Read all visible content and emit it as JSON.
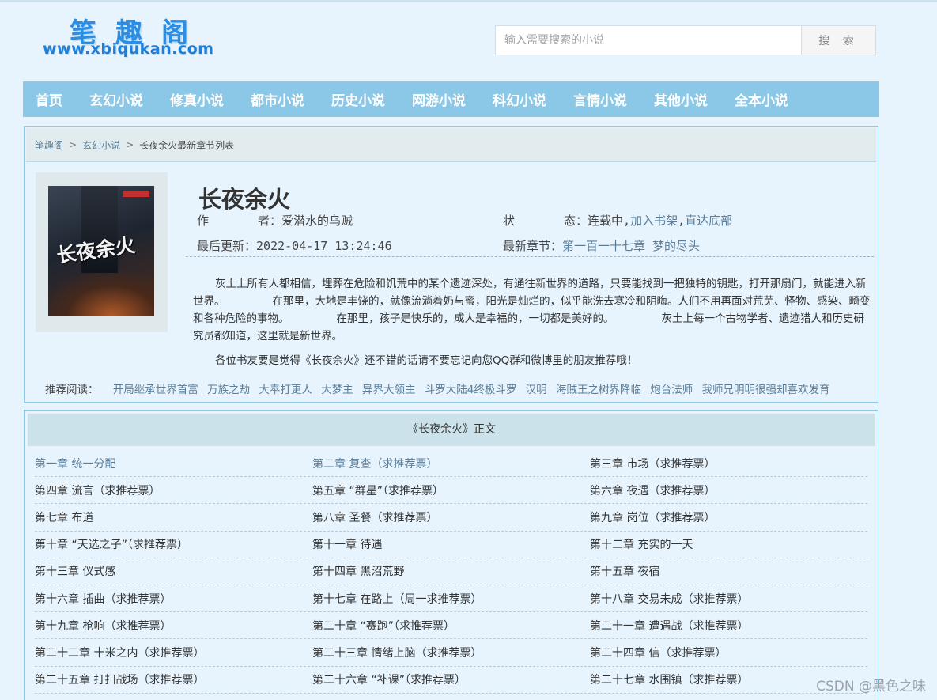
{
  "site": {
    "logo_title": "笔趣阁",
    "logo_url": "www.xbiqukan.com"
  },
  "search": {
    "placeholder": "输入需要搜索的小说",
    "button": "搜 索"
  },
  "nav": [
    "首页",
    "玄幻小说",
    "修真小说",
    "都市小说",
    "历史小说",
    "网游小说",
    "科幻小说",
    "言情小说",
    "其他小说",
    "全本小说"
  ],
  "breadcrumb": {
    "home": "笔趣阁",
    "category": "玄幻小说",
    "current": "长夜余火最新章节列表",
    "separator": ">"
  },
  "book": {
    "title": "长夜余火",
    "cover_title": "长夜余火",
    "author_label_a": "作",
    "author_label_b": "者：",
    "author": "爱潜水的乌贼",
    "status_label_a": "状",
    "status_label_b": "态：",
    "status": "连载中,",
    "add_shelf": "加入书架",
    "comma": ",",
    "to_bottom": "直达底部",
    "updated_label": "最后更新：",
    "updated": "2022-04-17 13:24:46",
    "latest_label": "最新章节：",
    "latest": "第一百一十七章 梦的尽头",
    "intro_1": "灰土上所有人都相信，埋葬在危险和饥荒中的某个遗迹深处，有通往新世界的道路，只要能找到一把独特的钥匙，打开那扇门，就能进入新世界。",
    "intro_2": "在那里，大地是丰饶的，就像流淌着奶与蜜，阳光是灿烂的，似乎能洗去寒冷和阴晦。人们不用再面对荒芜、怪物、感染、畸变和各种危险的事物。",
    "intro_3": "在那里，孩子是快乐的，成人是幸福的，一切都是美好的。",
    "intro_4": "灰土上每一个古物学者、遗迹猎人和历史研究员都知道，这里就是新世界。",
    "tip": "各位书友要是觉得《长夜余火》还不错的话请不要忘记向您QQ群和微博里的朋友推荐哦！"
  },
  "recommend": {
    "label": "推荐阅读：",
    "items": [
      "开局继承世界首富",
      "万族之劫",
      "大奉打更人",
      "大梦主",
      "异界大领主",
      "斗罗大陆4终极斗罗",
      "汉明",
      "海贼王之树界降临",
      "炮台法师",
      "我师兄明明很强却喜欢发育"
    ]
  },
  "chapters": {
    "heading": "《长夜余火》正文",
    "rows": [
      [
        "第一章 统一分配",
        "第二章 复查（求推荐票）",
        "第三章 市场（求推荐票）"
      ],
      [
        "第四章 流言（求推荐票）",
        "第五章 “群星”（求推荐票）",
        "第六章 夜遇（求推荐票）"
      ],
      [
        "第七章 布道",
        "第八章 圣餐（求推荐票）",
        "第九章 岗位（求推荐票）"
      ],
      [
        "第十章 “天选之子”（求推荐票）",
        "第十一章 待遇",
        "第十二章 充实的一天"
      ],
      [
        "第十三章 仪式感",
        "第十四章 黑沼荒野",
        "第十五章 夜宿"
      ],
      [
        "第十六章 插曲（求推荐票）",
        "第十七章 在路上（周一求推荐票）",
        "第十八章 交易未成（求推荐票）"
      ],
      [
        "第十九章 枪响（求推荐票）",
        "第二十章 “赛跑”（求推荐票）",
        "第二十一章 遭遇战（求推荐票）"
      ],
      [
        "第二十二章 十米之内（求推荐票）",
        "第二十三章 情绪上脑（求推荐票）",
        "第二十四章 信（求推荐票）"
      ],
      [
        "第二十五章 打扫战场（求推荐票）",
        "第二十六章 “补课”（求推荐票）",
        "第二十七章 水围镇（求推荐票）"
      ]
    ]
  },
  "watermark": "CSDN @黑色之味",
  "colors": {
    "background": "#e7f4fe",
    "nav": "#8bc7e6",
    "link": "#5b7d97",
    "logo": "#2b8de3"
  }
}
